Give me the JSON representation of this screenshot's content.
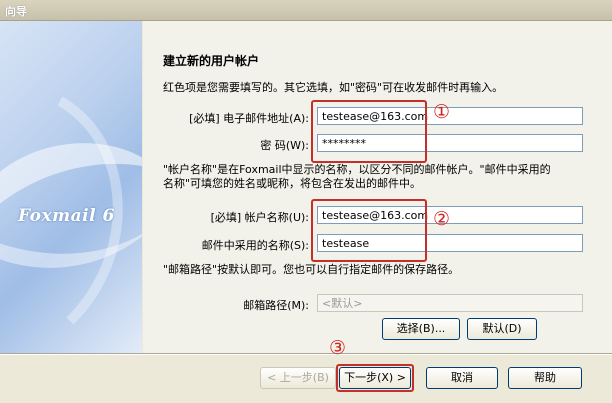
{
  "window": {
    "title": "向导"
  },
  "banner": {
    "brand": "Foxmail 6"
  },
  "main": {
    "heading": "建立新的用户帐户",
    "intro": "红色项是您需要填写的。其它选填，如\"密码\"可在收发邮件时再输入。",
    "email_label": "[必填] 电子邮件地址(A):",
    "email_value": "testease@163.com",
    "password_label": "密 码(W):",
    "password_value": "********",
    "account_note_1": "\"帐户名称\"是在Foxmail中显示的名称，以区分不同的邮件帐户。\"邮件中采用的",
    "account_note_2": "名称\"可填您的姓名或昵称，将包含在发出的邮件中。",
    "account_label": "[必填] 帐户名称(U):",
    "account_value": "testease@163.com",
    "name_label": "邮件中采用的名称(S):",
    "name_value": "testease",
    "path_note": "\"邮箱路径\"按默认即可。您也可以自行指定邮件的保存路径。",
    "path_label": "邮箱路径(M):",
    "path_value": "<默认>",
    "browse_label": "选择(B)...",
    "default_label": "默认(D)"
  },
  "annotations": {
    "one": "①",
    "two": "②",
    "three": "③",
    "color": "#d3241d"
  },
  "footer": {
    "back_label": "< 上一步(B)",
    "next_label": "下一步(X) >",
    "cancel_label": "取消",
    "help_label": "帮助"
  }
}
